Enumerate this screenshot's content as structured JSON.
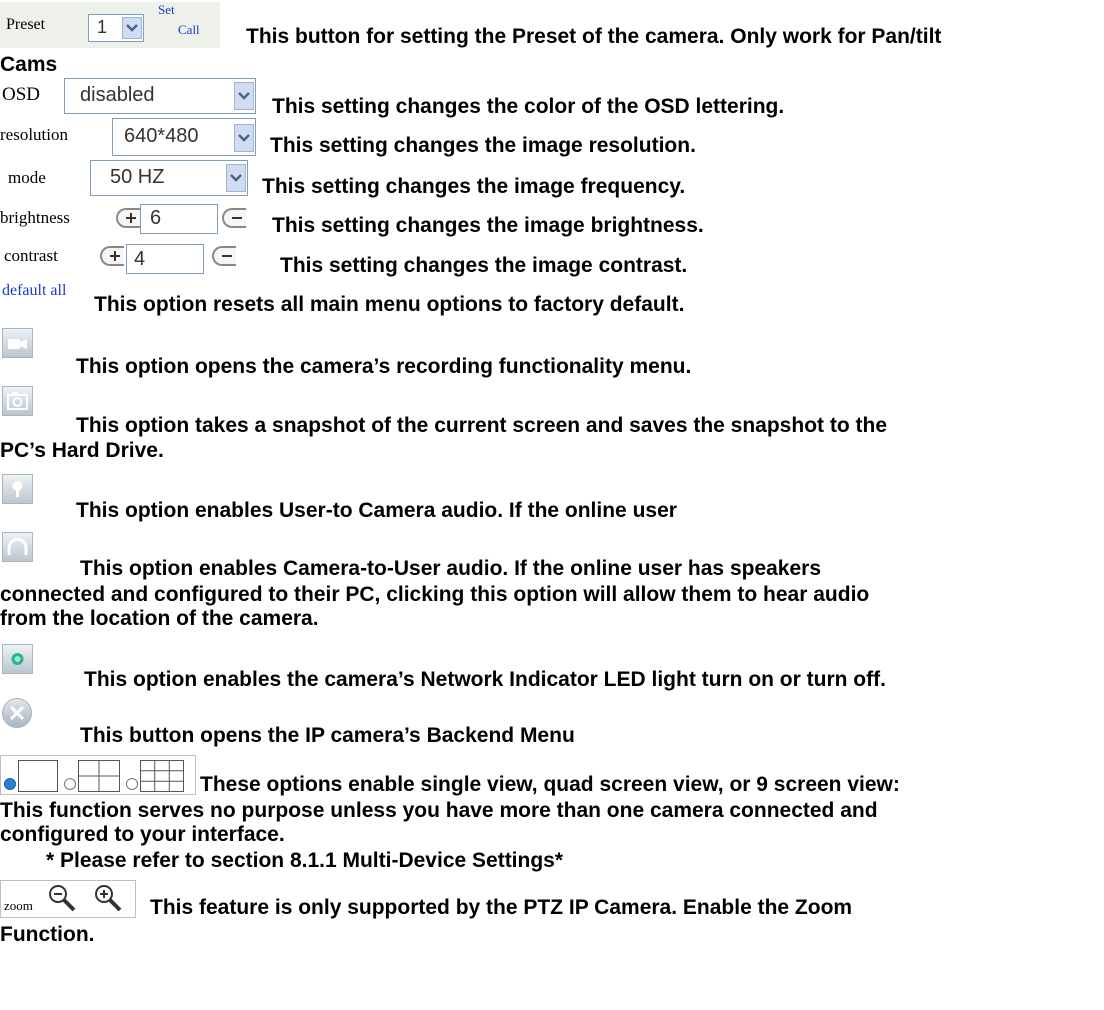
{
  "preset": {
    "label": "Preset",
    "value": "1",
    "set_label": "Set",
    "call_label": "Call",
    "desc": "This button for setting the Preset of the camera. Only work for Pan/tilt",
    "desc_cont": "Cams"
  },
  "osd": {
    "label": "OSD",
    "value": "disabled",
    "desc": "This setting changes the color of the OSD lettering."
  },
  "resolution": {
    "label": "resolution",
    "value": "640*480",
    "desc": "This setting changes the image resolution."
  },
  "mode": {
    "label": "mode",
    "value": "50 HZ",
    "desc": "This setting changes the image frequency."
  },
  "brightness": {
    "label": "brightness",
    "value": "6",
    "desc": "This setting changes the image brightness."
  },
  "contrast": {
    "label": "contrast",
    "value": "4",
    "desc": "This setting changes the image contrast."
  },
  "default_all": {
    "label": "default all",
    "desc": "This option resets all main menu options to factory default."
  },
  "record": {
    "icon": "video-camera-icon",
    "desc": "This option opens the camera’s recording functionality menu."
  },
  "snapshot": {
    "icon": "camera-icon",
    "desc_line1": "This option takes a snapshot of the current screen and saves the snapshot to the",
    "desc_line2": "PC’s Hard Drive."
  },
  "talk": {
    "icon": "microphone-icon",
    "desc": "This option enables User-to Camera audio. If the online user"
  },
  "listen": {
    "icon": "headphones-icon",
    "desc_line1": "This option enables Camera-to-User audio. If the online user has speakers",
    "desc_line2": "connected and configured to their PC, clicking this option will allow them to hear audio",
    "desc_line3": "from the location of the camera."
  },
  "led": {
    "icon": "led-indicator-icon",
    "desc": "This option enables the camera’s Network Indicator LED light turn on or turn off."
  },
  "backend": {
    "icon": "tools-icon",
    "desc": "This button opens the IP camera’s Backend Menu"
  },
  "views": {
    "desc_line1": "These options enable single view, quad screen view, or 9 screen view:",
    "desc_line2": "This function serves no purpose unless you have more than one camera connected and",
    "desc_line3": "configured to your interface.",
    "note": "* Please refer to section 8.1.1 Multi-Device Settings*"
  },
  "zoom": {
    "label": "zoom",
    "desc_line1": "This feature is only supported by the PTZ IP Camera. Enable the Zoom",
    "desc_line2": "Function."
  },
  "colors": {
    "link_blue": "#1a3cc8",
    "select_border": "#7f9db9",
    "arrow_fill": "#cfdcf1",
    "radio_selected": "#2a7fd4"
  }
}
